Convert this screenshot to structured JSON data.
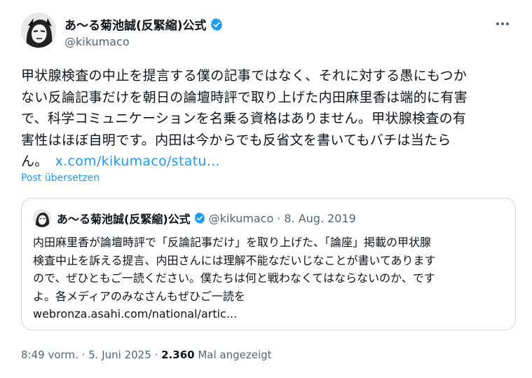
{
  "author": {
    "display_name": "あ〜る菊池誠(反緊縮)公式",
    "handle": "@kikumaco",
    "verified_icon": "verified-badge-icon"
  },
  "tweet": {
    "lines": [
      "甲状腺検査の中止を提言する僕の記事ではなく、それに対する愚にもつか",
      "ない反論記事だけを朝日の論壇時評で取り上げた内田麻里香は端的に有害",
      "で、科学コミュニケーションを名乗る資格はありません。甲状腺検査の有",
      "害性はほぼ自明です。内田は今からでも反省文を書いてもバチは当たら",
      "ん。"
    ],
    "link_text": "x.com/kikumaco/statu…",
    "translate_label": "Post übersetzen"
  },
  "quote": {
    "display_name": "あ〜る菊池誠(反緊縮)公式",
    "handle": "@kikumaco",
    "separator": "·",
    "date": "8. Aug. 2019",
    "lines": [
      "内田麻里香が論壇時評で「反論記事だけ」を取り上げた、「論座」掲載の甲状腺",
      "検査中止を訴える提言、内田さんには理解不能なだいじなことが書いてあります",
      "ので、ぜひともご一読ください。僕たちは何と戦わなくてはならないのか、です",
      "よ。各メディアのみなさんもぜひご一読を",
      "webronza.asahi.com/national/artic..."
    ]
  },
  "meta": {
    "time": "8:49 vorm.",
    "separator": "·",
    "date": "5. Juni 2025",
    "separator2": "·",
    "views": "2.360",
    "views_label": "Mal angezeigt"
  },
  "colors": {
    "accent": "#1d9bf0",
    "text": "#0f1419",
    "secondary": "#536471",
    "border": "#cfd9de"
  }
}
